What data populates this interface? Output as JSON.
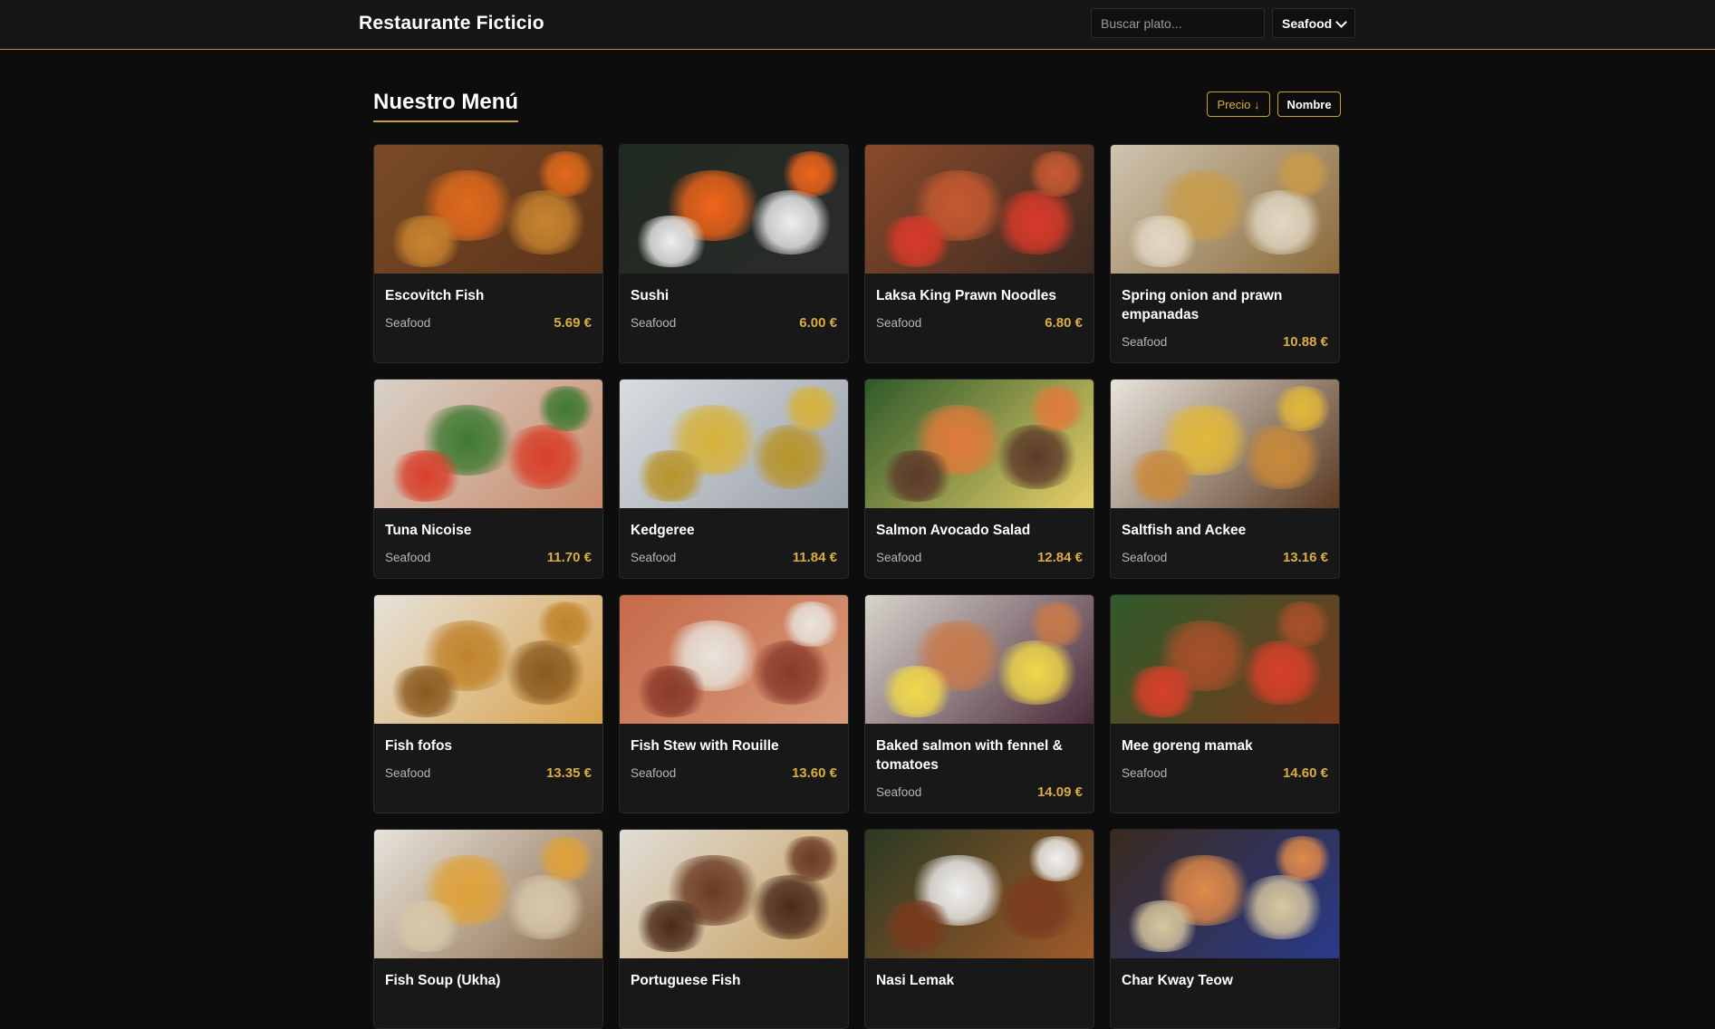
{
  "header": {
    "brand": "Restaurante Ficticio",
    "search_placeholder": "Buscar plato...",
    "category_selected": "Seafood"
  },
  "menu": {
    "title": "Nuestro Menú",
    "sort_price_label": "Precio ↓",
    "sort_name_label": "Nombre"
  },
  "dishes": [
    {
      "name": "Escovitch Fish",
      "category": "Seafood",
      "price": "5.69 €",
      "colors": [
        "#7a4a26",
        "#e06a1c",
        "#c8842f",
        "#5b341a"
      ]
    },
    {
      "name": "Sushi",
      "category": "Seafood",
      "price": "6.00 €",
      "colors": [
        "#1f2a1f",
        "#f0651a",
        "#eeeeee",
        "#2b2b2b"
      ]
    },
    {
      "name": "Laksa King Prawn Noodles",
      "category": "Seafood",
      "price": "6.80 €",
      "colors": [
        "#8a4a2a",
        "#c75a32",
        "#d93a2a",
        "#3b2a22"
      ]
    },
    {
      "name": "Spring onion and prawn empanadas",
      "category": "Seafood",
      "price": "10.88 €",
      "colors": [
        "#cfc4b0",
        "#c89c4a",
        "#e2d8c4",
        "#8a6a3a"
      ]
    },
    {
      "name": "Tuna Nicoise",
      "category": "Seafood",
      "price": "11.70 €",
      "colors": [
        "#d8d2c8",
        "#3f7a32",
        "#d8402a",
        "#c98a6a"
      ]
    },
    {
      "name": "Kedgeree",
      "category": "Seafood",
      "price": "11.84 €",
      "colors": [
        "#d9dde2",
        "#d6b23a",
        "#b8942a",
        "#9aa0a8"
      ]
    },
    {
      "name": "Salmon Avocado Salad",
      "category": "Seafood",
      "price": "12.84 €",
      "colors": [
        "#2f5a2a",
        "#e07a3a",
        "#5d3a2a",
        "#e8d06a"
      ]
    },
    {
      "name": "Saltfish and Ackee",
      "category": "Seafood",
      "price": "13.16 €",
      "colors": [
        "#e8e4dc",
        "#e2b83a",
        "#c98a3a",
        "#5a3a22"
      ]
    },
    {
      "name": "Fish fofos",
      "category": "Seafood",
      "price": "13.35 €",
      "colors": [
        "#e6e2da",
        "#c0832a",
        "#8a5a1e",
        "#d8a04a"
      ]
    },
    {
      "name": "Fish Stew with Rouille",
      "category": "Seafood",
      "price": "13.60 €",
      "colors": [
        "#c66a4a",
        "#e8e4dc",
        "#8a3a2a",
        "#d89a7a"
      ]
    },
    {
      "name": "Baked salmon with fennel & tomatoes",
      "category": "Seafood",
      "price": "14.09 €",
      "colors": [
        "#d8d4cc",
        "#c87a4a",
        "#f0d84a",
        "#4a2a3a"
      ]
    },
    {
      "name": "Mee goreng mamak",
      "category": "Seafood",
      "price": "14.60 €",
      "colors": [
        "#2f5a2a",
        "#a8502a",
        "#d8402a",
        "#7a3a1e"
      ]
    },
    {
      "name": "Fish Soup (Ukha)",
      "category": "",
      "price": "",
      "colors": [
        "#e8e4dc",
        "#e0a23a",
        "#d8c8a8",
        "#8a6a4a"
      ]
    },
    {
      "name": "Portuguese Fish",
      "category": "",
      "price": "",
      "colors": [
        "#e0ddd6",
        "#6a3a22",
        "#4a2a1a",
        "#c8a060"
      ]
    },
    {
      "name": "Nasi Lemak",
      "category": "",
      "price": "",
      "colors": [
        "#2a3a22",
        "#f0f0f0",
        "#7a3a1e",
        "#a05a2a"
      ]
    },
    {
      "name": "Char Kway Teow",
      "category": "",
      "price": "",
      "colors": [
        "#3a2a1e",
        "#e08a4a",
        "#d8c8a0",
        "#2a3a8a"
      ]
    }
  ]
}
